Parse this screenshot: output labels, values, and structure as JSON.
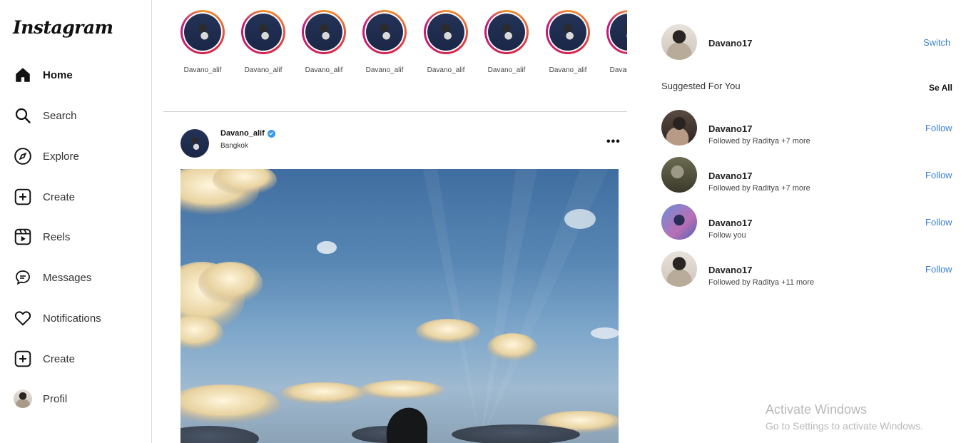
{
  "app": {
    "logo": "Instagram"
  },
  "sidebar": {
    "items": [
      {
        "label": "Home",
        "icon": "home-icon"
      },
      {
        "label": "Search",
        "icon": "search-icon"
      },
      {
        "label": "Explore",
        "icon": "compass-icon"
      },
      {
        "label": "Create",
        "icon": "plus-square-icon"
      },
      {
        "label": "Reels",
        "icon": "reels-icon"
      },
      {
        "label": "Messages",
        "icon": "message-icon"
      },
      {
        "label": "Notifications",
        "icon": "heart-icon"
      },
      {
        "label": "Create",
        "icon": "plus-square-icon"
      },
      {
        "label": "Profil",
        "icon": "avatar"
      }
    ]
  },
  "stories": [
    {
      "name": "Davano_alif"
    },
    {
      "name": "Davano_alif"
    },
    {
      "name": "Davano_alif"
    },
    {
      "name": "Davano_alif"
    },
    {
      "name": "Davano_alif"
    },
    {
      "name": "Davano_alif"
    },
    {
      "name": "Davano_alif"
    },
    {
      "name": "Davano_alif"
    }
  ],
  "post": {
    "username": "Davano_alif",
    "location": "Bangkok",
    "more": "•••"
  },
  "right": {
    "me": {
      "name": "Davano17",
      "action": "Switch"
    },
    "suggested_title": "Suggested For You",
    "see_all": "Se All",
    "suggestions": [
      {
        "name": "Davano17",
        "sub": "Followed by Raditya +7 more",
        "action": "Follow"
      },
      {
        "name": "Davano17",
        "sub": "Followed by Raditya +7 more",
        "action": "Follow"
      },
      {
        "name": "Davano17",
        "sub": "Follow you",
        "action": "Follow"
      },
      {
        "name": "Davano17",
        "sub": "Followed by Raditya +11 more",
        "action": "Follow"
      }
    ]
  },
  "watermark": {
    "title": "Activate Windows",
    "sub": "Go to Settings to activate Windows."
  },
  "colors": {
    "link": "#3b82d6",
    "verified": "#3897f0"
  }
}
